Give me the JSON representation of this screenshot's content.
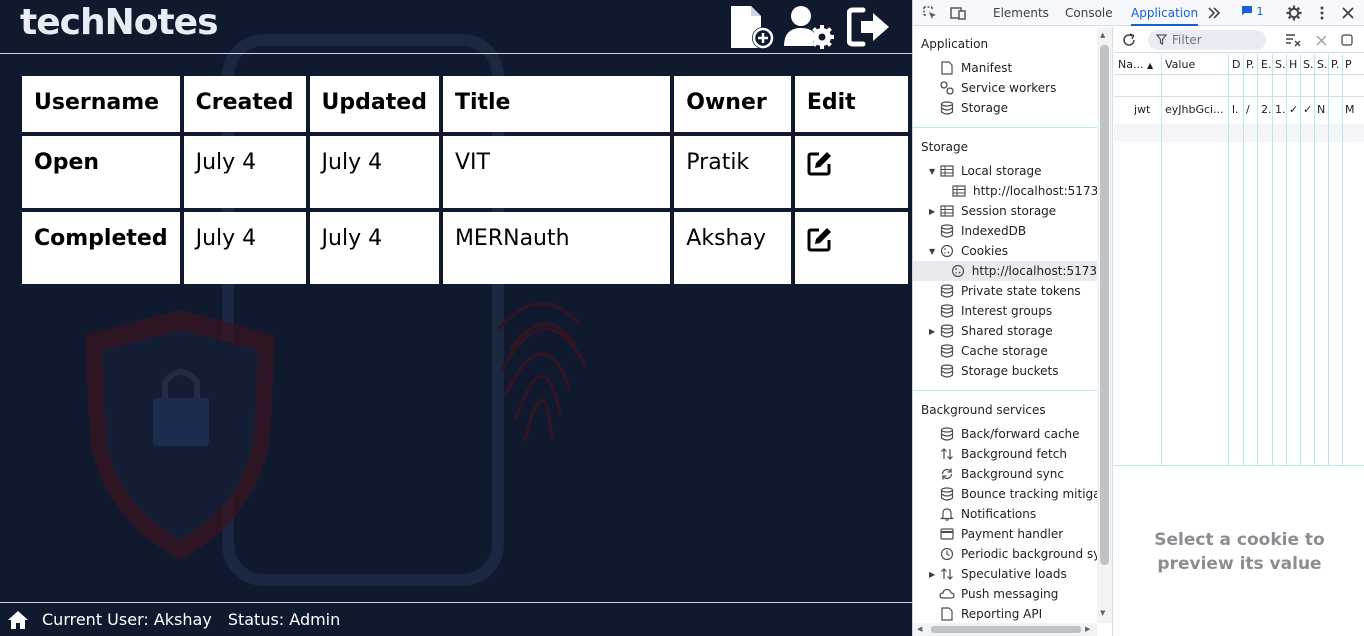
{
  "app": {
    "title": "techNotes",
    "table": {
      "headers": [
        "Username",
        "Created",
        "Updated",
        "Title",
        "Owner",
        "Edit"
      ],
      "rows": [
        {
          "username": "Open",
          "created": "July 4",
          "updated": "July 4",
          "title": "VIT",
          "owner": "Pratik",
          "status_color": "#a11d20"
        },
        {
          "username": "Completed",
          "created": "July 4",
          "updated": "July 4",
          "title": "MERNauth",
          "owner": "Akshay",
          "status_color": "#2ec02e"
        }
      ]
    },
    "footer": {
      "user": "Current User: Akshay",
      "status": "Status: Admin"
    },
    "icons": [
      "new-note-icon",
      "user-settings-icon",
      "logout-icon",
      "edit-icon",
      "home-icon"
    ]
  },
  "devtools": {
    "tabs": [
      "Elements",
      "Console",
      "Application"
    ],
    "active_tab": "Application",
    "issues_count": "1",
    "sidebar": {
      "application_head": "Application",
      "application_items": [
        "Manifest",
        "Service workers",
        "Storage"
      ],
      "storage_head": "Storage",
      "storage_items": [
        "Local storage",
        "http://localhost:5173",
        "Session storage",
        "IndexedDB",
        "Cookies",
        "http://localhost:5173",
        "Private state tokens",
        "Interest groups",
        "Shared storage",
        "Cache storage",
        "Storage buckets"
      ],
      "background_head": "Background services",
      "background_items": [
        "Back/forward cache",
        "Background fetch",
        "Background sync",
        "Bounce tracking mitigatic",
        "Notifications",
        "Payment handler",
        "Periodic background sync",
        "Speculative loads",
        "Push messaging",
        "Reporting API"
      ]
    },
    "cookies": {
      "filter_placeholder": "Filter",
      "columns": [
        "Na...",
        "Value",
        "D",
        "P.",
        "E.",
        "S.",
        "H",
        "S.",
        "S.",
        "P.",
        "P"
      ],
      "row": [
        "jwt",
        "eyJhbGci...",
        "l.",
        "/",
        "2.",
        "1.",
        "✓",
        "✓",
        "N",
        "",
        "M"
      ],
      "preview_text": "Select a cookie to preview its value"
    }
  }
}
